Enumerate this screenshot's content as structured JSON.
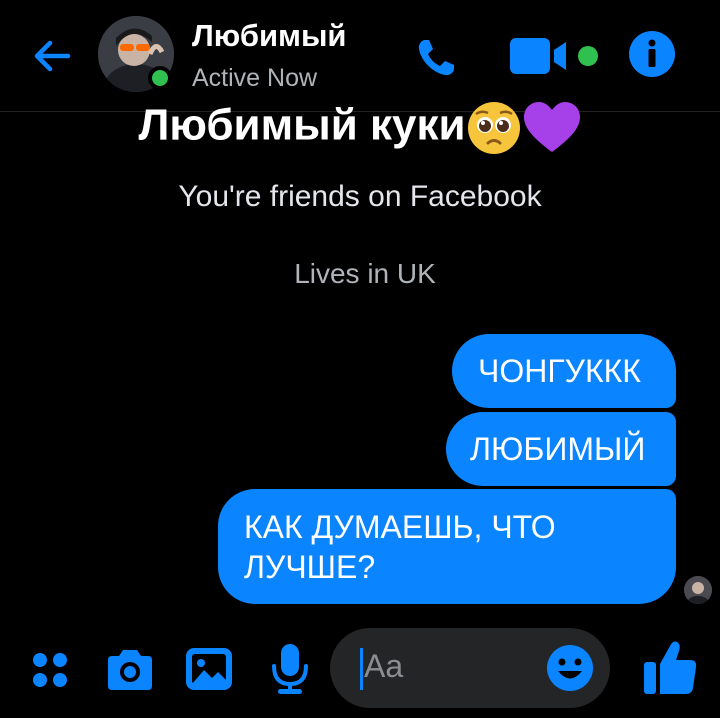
{
  "header": {
    "contact_name": "Любимый",
    "status": "Active Now",
    "icons": {
      "back": "back-arrow-icon",
      "call": "phone-icon",
      "video": "video-camera-icon",
      "info": "info-icon"
    }
  },
  "profile": {
    "display_name": "Любимый куки",
    "emojis": [
      "pleading-face-emoji",
      "purple-heart-emoji"
    ],
    "friends_text": "You're friends on Facebook",
    "lives_text": "Lives in UK"
  },
  "messages": [
    {
      "text": "ЧОНГУККК",
      "sender": "me"
    },
    {
      "text": "ЛЮБИМЫЙ",
      "sender": "me"
    },
    {
      "text": "КАК ДУМАЕШЬ, ЧТО ЛУЧШЕ?",
      "sender": "me"
    }
  ],
  "composer": {
    "placeholder": "Aa",
    "icons": [
      "menu-dots-icon",
      "camera-icon",
      "gallery-icon",
      "microphone-icon",
      "emoji-icon",
      "thumbs-up-icon"
    ]
  },
  "colors": {
    "accent": "#0A84FF",
    "online": "#30C04F",
    "background": "#000000",
    "input_bg": "#242526"
  }
}
